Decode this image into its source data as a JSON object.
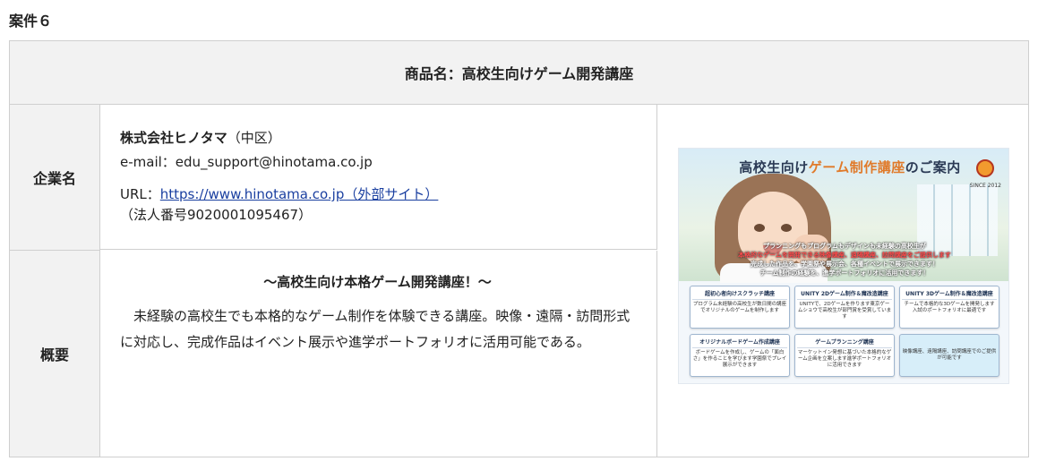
{
  "case_label": "案件６",
  "product": {
    "name": "商品名：高校生向けゲーム開発講座"
  },
  "company": {
    "row_label": "企業名",
    "name": "株式会社ヒノタマ",
    "area": "（中区）",
    "email_line": "e-mail：edu_support@hinotama.co.jp",
    "url_prefix": "URL：",
    "url_link": "https://www.hinotama.co.jp（外部サイト）",
    "corp_number": "（法人番号9020001095467）"
  },
  "summary": {
    "row_label": "概要",
    "heading": "～高校生向け本格ゲーム開発講座！～",
    "body": "未経験の高校生でも本格的なゲーム制作を体験できる講座。映像・遠隔・訪問形式に対応し、完成作品はイベント展示や進学ポートフォリオに活用可能である。"
  },
  "flyer": {
    "title_pre": "高校生向け",
    "title_accent": "ゲーム制作講座",
    "title_post": "のご案内",
    "since": "SINCE 2012",
    "caption_1": "プランニングもプログラムもデザインも未経験の高校生が",
    "caption_2": "本格的なゲームを開発できる映像講座、遠隔講座、訪問講座をご提供します",
    "caption_3": "完成した作品を、学園祭や展示会、各種イベントで展示できます！",
    "caption_4": "チーム制作の経験を、進学ポートフォリオに活用できます！",
    "cards": [
      {
        "title": "超初心者向けスクラッチ講座",
        "desc": "プログラム未経験の高校生が数日間の講座でオリジナルのゲームを制作します"
      },
      {
        "title": "UNITY 2Dゲーム制作＆魔改造講座",
        "desc": "UNITYで、2Dゲームを作ります東京ゲームショウで高校生が部門賞を受賞しています"
      },
      {
        "title": "UNITY 3Dゲーム制作＆魔改造講座",
        "desc": "チームで本格的な3Dゲームを開発します入試のポートフォリオに最適です"
      },
      {
        "title": "オリジナルボードゲーム作成講座",
        "desc": "ボードゲームを作成し、ゲームの「面白さ」を作ることを学びます学園祭でプレイ展示ができます"
      },
      {
        "title": "ゲームプランニング講座",
        "desc": "マーケットイン発想に基づいた本格的なゲーム企画を立案します進学ポートフォリオに活用できます"
      },
      {
        "title": "",
        "desc": "映像講座、遠隔講座、訪問講座でのご提供が可能です"
      }
    ]
  }
}
